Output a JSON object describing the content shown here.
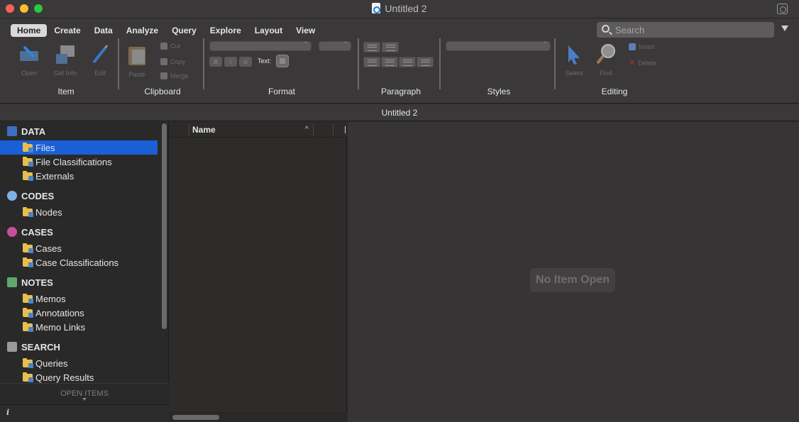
{
  "window": {
    "title": "Untitled 2",
    "icon": "document-icon"
  },
  "ribbon": {
    "tabs": [
      {
        "label": "Home",
        "active": true
      },
      {
        "label": "Create",
        "active": false
      },
      {
        "label": "Data",
        "active": false
      },
      {
        "label": "Analyze",
        "active": false
      },
      {
        "label": "Query",
        "active": false
      },
      {
        "label": "Explore",
        "active": false
      },
      {
        "label": "Layout",
        "active": false
      },
      {
        "label": "View",
        "active": false
      }
    ],
    "search": {
      "placeholder": "Search",
      "value": ""
    },
    "groups": {
      "item": {
        "label": "Item",
        "buttons": {
          "open": "Open",
          "get_info": "Get Info",
          "edit": "Edit"
        }
      },
      "clipboard": {
        "label": "Clipboard",
        "paste": "Paste",
        "cut": "Cut",
        "copy": "Copy",
        "merge": "Merge"
      },
      "format": {
        "label": "Format",
        "bold": "B",
        "italic": "I",
        "underline": "U",
        "text_label": "Text:"
      },
      "paragraph": {
        "label": "Paragraph"
      },
      "styles": {
        "label": "Styles"
      },
      "editing": {
        "label": "Editing",
        "select": "Select",
        "find": "Find",
        "insert": "Insert",
        "delete": "Delete"
      }
    }
  },
  "document_tab": {
    "title": "Untitled 2"
  },
  "sidebar": {
    "sections": [
      {
        "header": "DATA",
        "icon": "data-book-icon",
        "color": "#3d6fc2",
        "items": [
          {
            "label": "Files",
            "selected": true
          },
          {
            "label": "File Classifications",
            "selected": false
          },
          {
            "label": "Externals",
            "selected": false
          }
        ]
      },
      {
        "header": "CODES",
        "icon": "codes-sphere-icon",
        "color": "#7fb0e6",
        "items": [
          {
            "label": "Nodes",
            "selected": false
          }
        ]
      },
      {
        "header": "CASES",
        "icon": "cases-quadrant-icon",
        "color": "#c74f9a",
        "items": [
          {
            "label": "Cases",
            "selected": false
          },
          {
            "label": "Case Classifications",
            "selected": false
          }
        ]
      },
      {
        "header": "NOTES",
        "icon": "notes-pad-icon",
        "color": "#5fa86a",
        "items": [
          {
            "label": "Memos",
            "selected": false
          },
          {
            "label": "Annotations",
            "selected": false
          },
          {
            "label": "Memo Links",
            "selected": false
          }
        ]
      },
      {
        "header": "SEARCH",
        "icon": "search-binoculars-icon",
        "color": "#9a9a9a",
        "items": [
          {
            "label": "Queries",
            "selected": false
          },
          {
            "label": "Query Results",
            "selected": false
          }
        ]
      }
    ],
    "open_items_label": "OPEN ITEMS",
    "info_label": "i"
  },
  "list": {
    "columns": {
      "name": "Name"
    },
    "sort_indicator": "^"
  },
  "detail": {
    "empty_message": "No Item Open"
  },
  "colors": {
    "selection": "#1a5fd6",
    "chrome": "#3a3838",
    "panel": "#2a2929"
  }
}
